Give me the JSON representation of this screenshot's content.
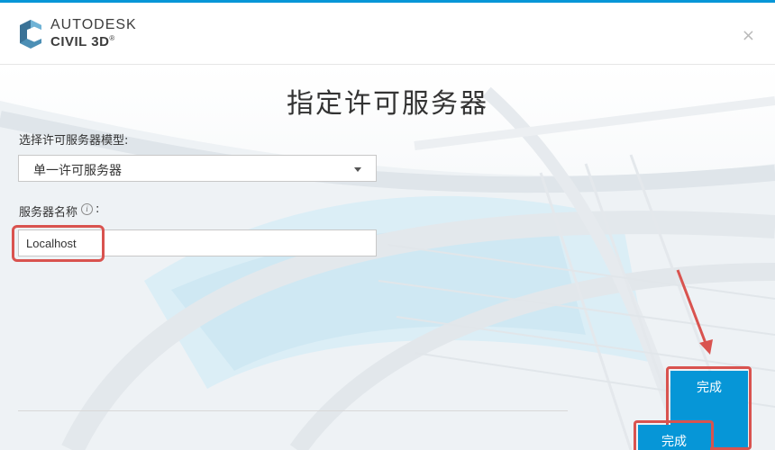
{
  "header": {
    "brand_line1": "AUTODESK",
    "brand_line2": "CIVIL 3D",
    "registered_mark": "®",
    "close_glyph": "×",
    "logo_icon": "civil3d-logo-icon",
    "close_icon": "close-icon"
  },
  "dialog": {
    "title": "指定许可服务器",
    "model_label": "选择许可服务器模型:",
    "model_select": {
      "selected": "单一许可服务器",
      "caret_icon": "chevron-down-icon"
    },
    "server_name_label": "服务器名称",
    "server_name_colon": ":",
    "info_glyph": "i",
    "info_icon": "info-icon",
    "server_name_value": "Localhost"
  },
  "footer": {
    "finish_label": "完成",
    "finish_label_partial": "完成"
  },
  "colors": {
    "accent": "#0696d7",
    "annotation_red": "#d9534f"
  }
}
